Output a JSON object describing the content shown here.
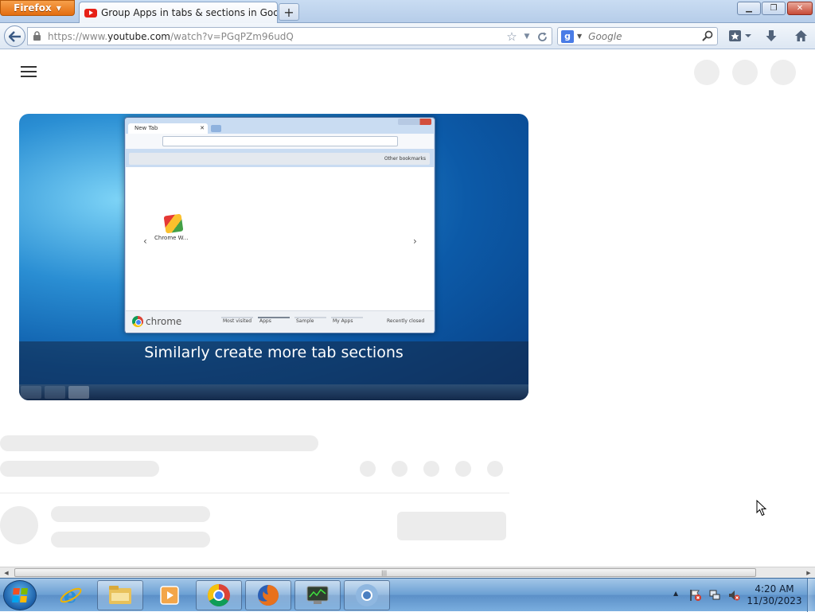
{
  "browser": {
    "menu_label": "Firefox",
    "tab_title": "Group Apps in tabs & sections in Google...",
    "url_scheme_prefix": "https://www.",
    "url_domain": "youtube.com",
    "url_path": "/watch?v=PGqPZm96udQ",
    "search_placeholder": "Google"
  },
  "video": {
    "caption": "Similarly create more tab sections",
    "embedded_browser": {
      "tab_label": "New Tab",
      "other_bookmarks": "Other bookmarks",
      "app_label": "Chrome W...",
      "brand": "chrome",
      "sections": [
        "Most visited",
        "Apps",
        "Sample",
        "My Apps"
      ],
      "recently_closed": "Recently closed"
    }
  },
  "taskbar": {
    "time": "4:20 AM",
    "date": "11/30/2023"
  },
  "colors": {
    "firefox_orange": "#e26d10",
    "youtube_red": "#e62117",
    "placeholder_gray": "#ececec",
    "taskbar_blue": "#6a9fd3"
  },
  "icons": [
    "firefox-menu",
    "youtube-icon",
    "back-arrow-icon",
    "lock-icon",
    "bookmark-star-icon",
    "reload-icon",
    "google-icon",
    "search-icon",
    "bookmarks-menu-icon",
    "download-icon",
    "home-icon",
    "hamburger-menu-icon",
    "start-orb-icon",
    "ie-icon",
    "explorer-icon",
    "media-player-icon",
    "chrome-icon",
    "firefox-icon",
    "task-manager-icon",
    "chromium-icon",
    "action-center-icon",
    "network-icon",
    "volume-muted-icon",
    "mouse-cursor-icon"
  ]
}
